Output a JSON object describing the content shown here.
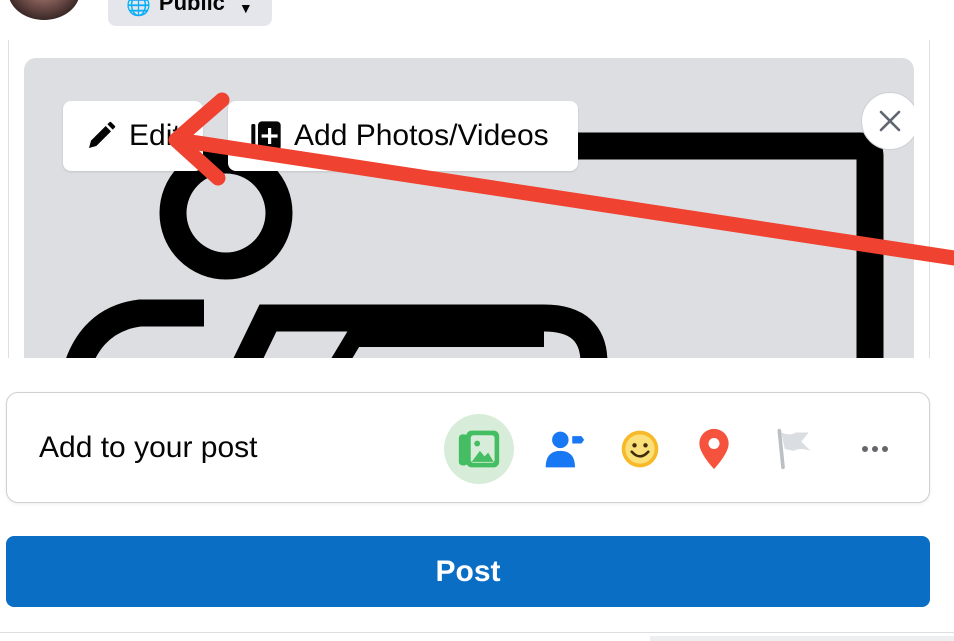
{
  "header": {
    "privacy_label": "Public",
    "privacy_icon": "globe-icon",
    "caret_icon": "chevron-down-icon"
  },
  "media": {
    "edit_label": "Edit",
    "edit_icon": "pencil-icon",
    "add_label": "Add Photos/Videos",
    "add_icon": "add-photo-icon",
    "close_icon": "close-icon"
  },
  "add_to_post": {
    "label": "Add to your post",
    "tools": [
      {
        "name": "photo-video-icon",
        "color": "#45bd62"
      },
      {
        "name": "tag-people-icon",
        "color": "#1877f2"
      },
      {
        "name": "feeling-activity-icon",
        "color": "#f7b928"
      },
      {
        "name": "check-in-icon",
        "color": "#f5533d"
      },
      {
        "name": "life-event-flag-icon",
        "color": "#bcc0c4"
      },
      {
        "name": "more-options-icon",
        "color": "#65676b"
      }
    ]
  },
  "post_button": {
    "label": "Post",
    "color": "#0a6ec5"
  },
  "annotation": {
    "arrow_color": "#ef4230"
  }
}
